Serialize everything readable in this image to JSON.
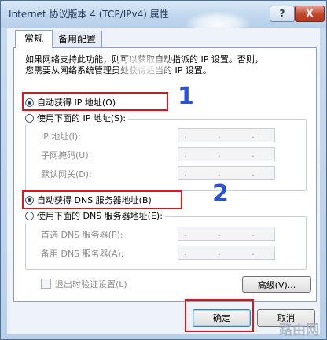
{
  "window": {
    "title": "Internet 协议版本 4 (TCP/IPv4) 属性",
    "help_label": "?",
    "close_label": "X"
  },
  "tabs": [
    {
      "label": "常规"
    },
    {
      "label": "备用配置"
    }
  ],
  "description": {
    "line1": "如果网络支持此功能，则可以获取自动指派的 IP 设置。否则，",
    "line2": "您需要从网络系统管理员处获得适当的 IP 设置。"
  },
  "ip_section": {
    "auto_label": "自动获得 IP 地址(O)",
    "manual_label": "使用下面的 IP 地址(S):",
    "auto_selected": true,
    "fields": [
      {
        "label": "IP 地址(I):",
        "value": ". . ."
      },
      {
        "label": "子网掩码(U):",
        "value": ". . ."
      },
      {
        "label": "默认网关(D):",
        "value": ". . ."
      }
    ]
  },
  "dns_section": {
    "auto_label": "自动获得 DNS 服务器地址(B)",
    "manual_label": "使用下面的 DNS 服务器地址(E):",
    "auto_selected": true,
    "fields": [
      {
        "label": "首选 DNS 服务器(P):",
        "value": ". . ."
      },
      {
        "label": "备用 DNS 服务器(A):",
        "value": ". . ."
      }
    ]
  },
  "validate_checkbox": {
    "label": "退出时验证设置(L)",
    "checked": false
  },
  "advanced_button": {
    "label": "高级(V)..."
  },
  "ok_button": {
    "label": "确定"
  },
  "cancel_button": {
    "label": "取消"
  },
  "annotations": {
    "step1": "1",
    "step2": "2",
    "box_color": "#e0151b",
    "number_color": "#2a52d6"
  },
  "watermark": "路由网"
}
